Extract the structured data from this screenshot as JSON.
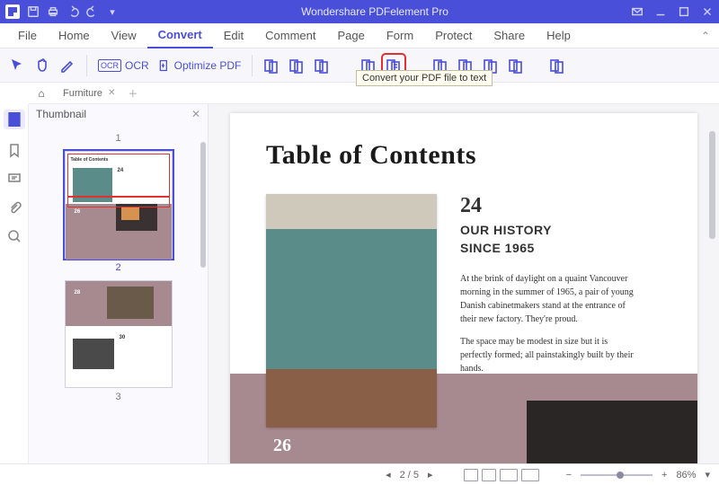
{
  "title": "Wondershare PDFelement Pro",
  "menu": [
    "File",
    "Home",
    "View",
    "Convert",
    "Edit",
    "Comment",
    "Page",
    "Form",
    "Protect",
    "Share",
    "Help"
  ],
  "menu_active": "Convert",
  "ribbon": {
    "ocr_label": "OCR",
    "optimize_label": "Optimize PDF"
  },
  "tooltip": "Convert your PDF file to text",
  "tabs": {
    "current": "Furniture"
  },
  "sidepanel": {
    "title": "Thumbnail",
    "pages": [
      "1",
      "2",
      "3"
    ]
  },
  "document": {
    "heading": "Table of Contents",
    "num1": "24",
    "sub1a": "OUR HISTORY",
    "sub1b": "SINCE 1965",
    "para1": "At the brink of daylight on a quaint Vancouver morning in the summer of 1965, a pair of young Danish cabinetmakers stand at the entrance of their new factory. They're proud.",
    "para2": "The space may be modest in size but it is perfectly formed; all painstakingly built by their hands.",
    "num2": "26"
  },
  "status": {
    "page": "2 / 5",
    "zoom": "86%"
  }
}
